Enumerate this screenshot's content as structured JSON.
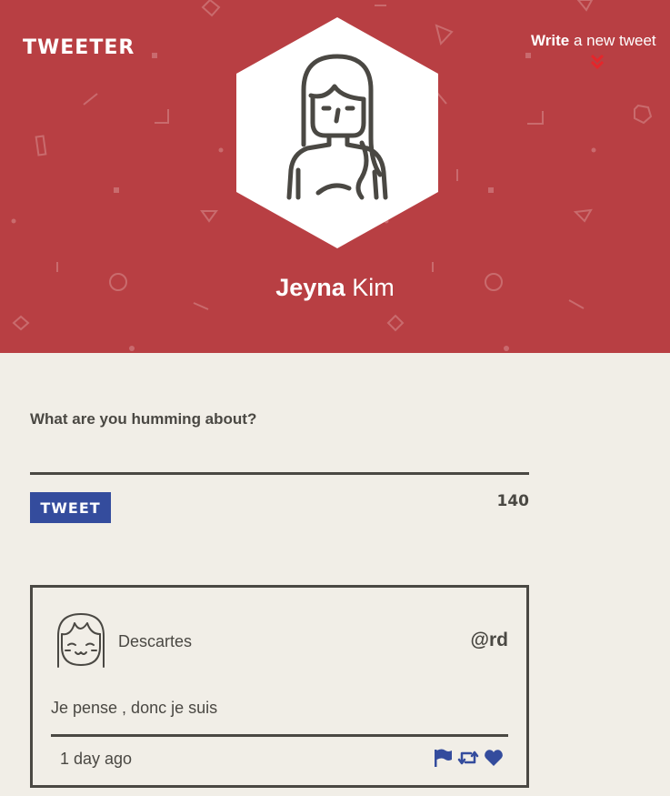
{
  "app": {
    "logo": "TWEETER",
    "write_link_bold": "Write",
    "write_link_rest": "a new tweet"
  },
  "profile": {
    "first_name": "Jeyna",
    "last_name": "Kim"
  },
  "composer": {
    "label": "What are you humming about?",
    "value": "",
    "placeholder": "",
    "button_label": "TWEET",
    "char_count": "140"
  },
  "tweets": [
    {
      "author": "Descartes",
      "handle": "@rd",
      "text": "Je pense , donc je suis",
      "time": "1 day ago"
    }
  ],
  "icons": {
    "chevrons": "double-chevron-down-icon",
    "flag": "flag-icon",
    "retweet": "retweet-icon",
    "heart": "heart-icon"
  },
  "colors": {
    "header_bg": "#b83f43",
    "page_bg": "#f1eee7",
    "accent_blue": "#344c9d",
    "text_dark": "#4a4843",
    "chevron_red": "#e5262b"
  }
}
